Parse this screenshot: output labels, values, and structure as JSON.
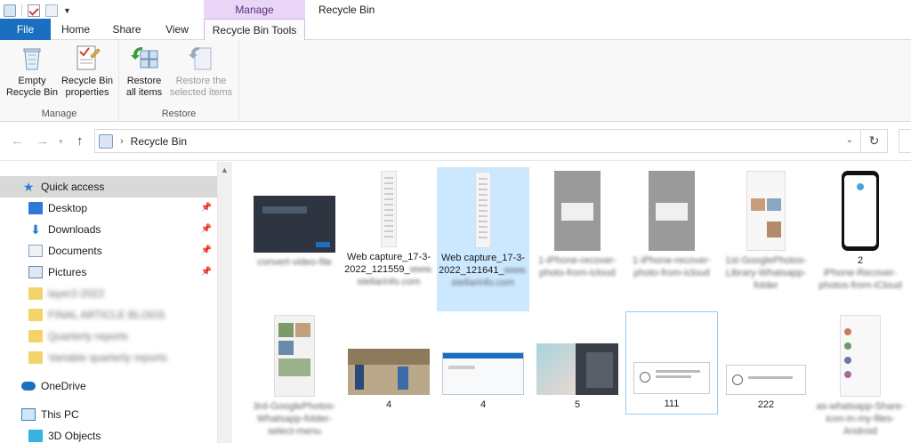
{
  "window": {
    "title": "Recycle Bin",
    "context_tab_group": "Manage"
  },
  "tabs": [
    {
      "label": "File"
    },
    {
      "label": "Home"
    },
    {
      "label": "Share"
    },
    {
      "label": "View"
    },
    {
      "label": "Recycle Bin Tools"
    }
  ],
  "ribbon": {
    "manage_group": {
      "label": "Manage",
      "empty_line1": "Empty",
      "empty_line2": "Recycle Bin",
      "props_line1": "Recycle Bin",
      "props_line2": "properties"
    },
    "restore_group": {
      "label": "Restore",
      "restore_all_line1": "Restore",
      "restore_all_line2": "all items",
      "restore_sel_line1": "Restore the",
      "restore_sel_line2": "selected items"
    }
  },
  "address": {
    "path": "Recycle Bin",
    "separator": "›"
  },
  "navpane": {
    "quick_access": "Quick access",
    "pinned": [
      {
        "label": "Desktop"
      },
      {
        "label": "Downloads"
      },
      {
        "label": "Documents"
      },
      {
        "label": "Pictures"
      }
    ],
    "blurred_folders": [
      "layer2-2022",
      "FINAL ARTICLE BLOGS",
      "Quarterly reports",
      "Variable quarterly reports"
    ],
    "onedrive": "OneDrive",
    "this_pc": "This PC",
    "objects3d": "3D Objects"
  },
  "items_row1": [
    {
      "caption": "",
      "caption_blur": "convert-video-file"
    },
    {
      "caption": "Web capture_17-3-2022_121559_",
      "caption_blur": "www.stellarinfo.com"
    },
    {
      "caption": "Web capture_17-3-2022_121641_",
      "caption_blur": "www.stellarinfo.com"
    },
    {
      "caption": "",
      "caption_blur": "1-iPhone-recover-photo-from-icloud"
    },
    {
      "caption": "",
      "caption_blur": "1-iPhone-recover-photo-from-icloud"
    },
    {
      "caption": "",
      "caption_blur": "1st-GooglePhotos-Library-Whatsapp-folder"
    },
    {
      "caption": "2",
      "caption_blur": "iPhone-Recover-photos-from-iCloud"
    }
  ],
  "items_row2": [
    {
      "caption": "",
      "caption_blur": "3rd-GooglePhotos-Whatsapp-folder-select-menu"
    },
    {
      "caption": "4",
      "caption_blur": ""
    },
    {
      "caption": "4",
      "caption_blur": ""
    },
    {
      "caption": "5",
      "caption_blur": ""
    },
    {
      "caption": "111",
      "caption_blur": ""
    },
    {
      "caption": "222",
      "caption_blur": ""
    },
    {
      "caption": "",
      "caption_blur": "as-whatsapp-Share-icon-in-my-files-Android"
    }
  ]
}
